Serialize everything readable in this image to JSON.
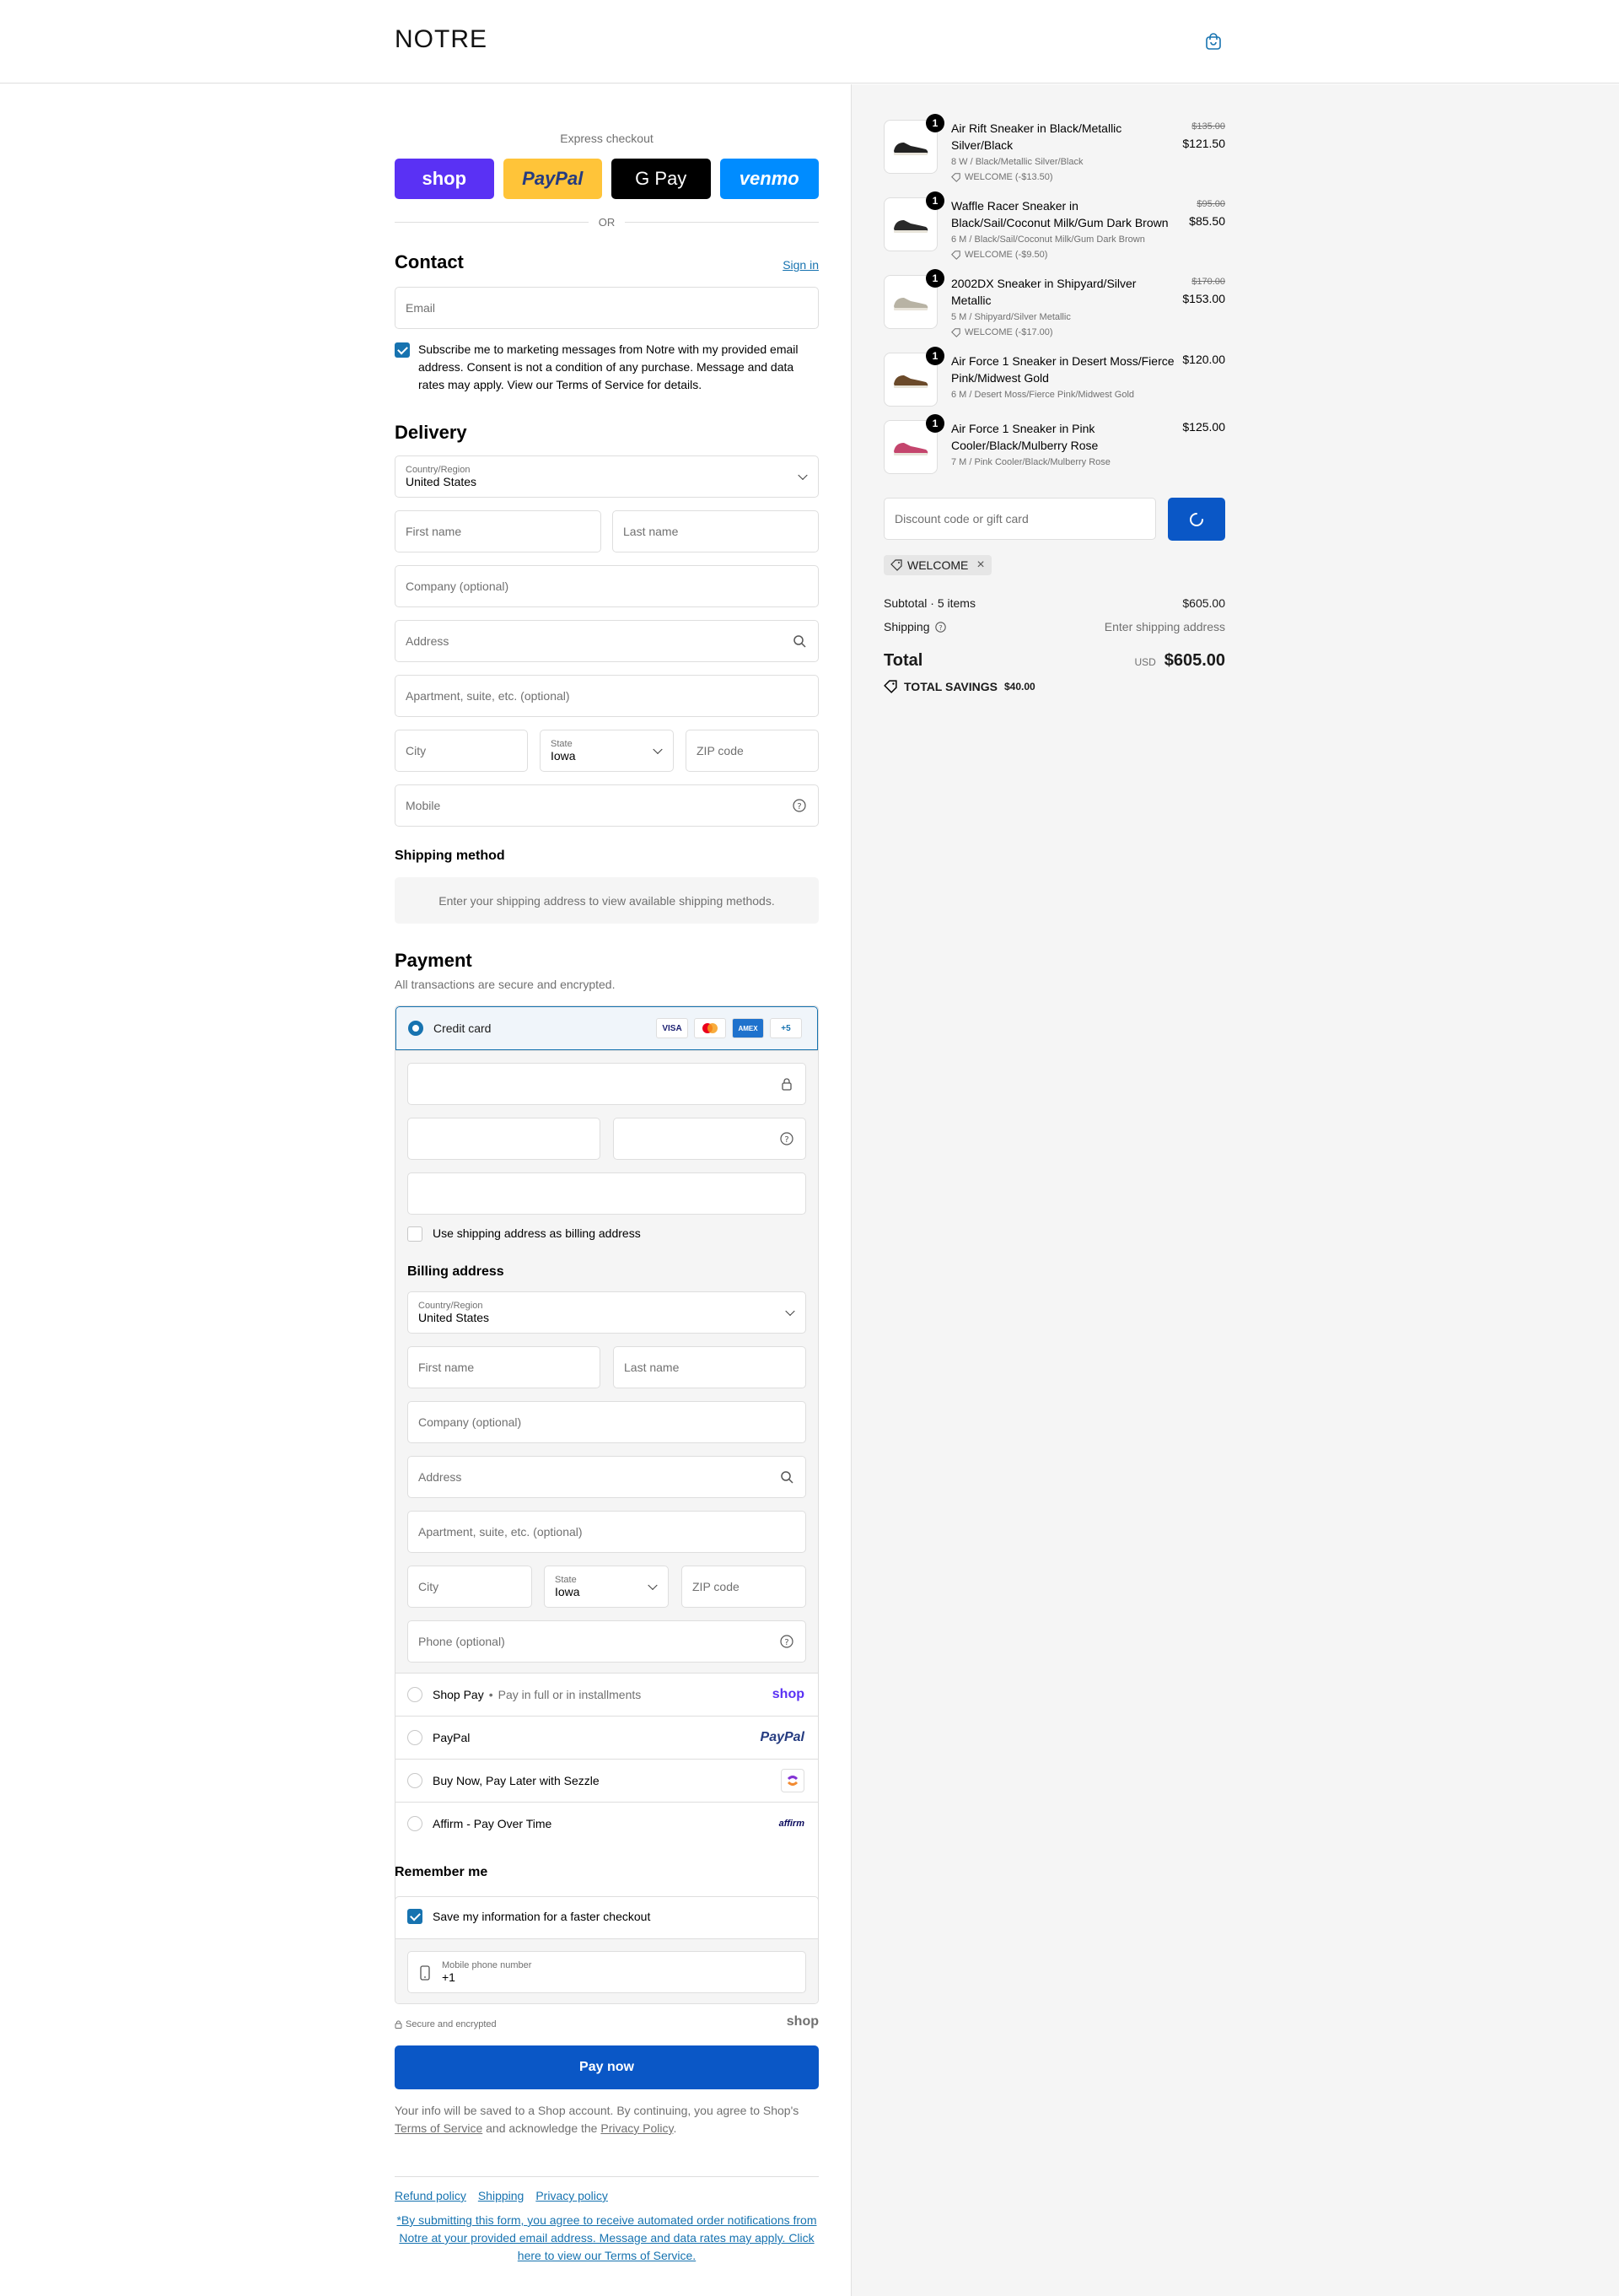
{
  "brand": "NOTRE",
  "express": {
    "title": "Express checkout",
    "buttons": [
      "shop",
      "PayPal",
      "G Pay",
      "venmo"
    ],
    "or": "OR"
  },
  "contact": {
    "title": "Contact",
    "sign_in": "Sign in",
    "email_placeholder": "Email",
    "subscribe_text": "Subscribe me to marketing messages from Notre with my provided email address. Consent is not a condition of any purchase. Message and data rates may apply. View our Terms of Service for details."
  },
  "delivery": {
    "title": "Delivery",
    "country_label": "Country/Region",
    "country_value": "United States",
    "first_name": "First name",
    "last_name": "Last name",
    "company": "Company (optional)",
    "address": "Address",
    "apartment": "Apartment, suite, etc. (optional)",
    "city": "City",
    "state_label": "State",
    "state_value": "Iowa",
    "zip": "ZIP code",
    "mobile": "Mobile"
  },
  "shipping_method": {
    "title": "Shipping method",
    "message": "Enter your shipping address to view available shipping methods."
  },
  "payment": {
    "title": "Payment",
    "subtitle": "All transactions are secure and encrypted.",
    "credit_card": "Credit card",
    "card_badges": [
      "VISA",
      "MC",
      "AMEX",
      "+5"
    ],
    "use_shipping": "Use shipping address as billing address",
    "billing_title": "Billing address",
    "billing": {
      "country_label": "Country/Region",
      "country_value": "United States",
      "first_name": "First name",
      "last_name": "Last name",
      "company": "Company (optional)",
      "address": "Address",
      "apartment": "Apartment, suite, etc. (optional)",
      "city": "City",
      "state_label": "State",
      "state_value": "Iowa",
      "zip": "ZIP code",
      "phone": "Phone (optional)"
    },
    "shop_pay": "Shop Pay",
    "shop_pay_sub": "Pay in full or in installments",
    "shop_logo": "shop",
    "paypal": "PayPal",
    "paypal_logo": "PayPal",
    "sezzle": "Buy Now, Pay Later with Sezzle",
    "affirm": "Affirm - Pay Over Time",
    "affirm_logo": "affirm"
  },
  "remember": {
    "title": "Remember me",
    "save_label": "Save my information for a faster checkout",
    "phone_label": "Mobile phone number",
    "phone_value": "+1"
  },
  "secure": "Secure and encrypted",
  "secure_logo": "shop",
  "pay_now": "Pay now",
  "legal": {
    "p1": "Your info will be saved to a Shop account. By continuing, you agree to Shop's",
    "tos": "Terms of Service",
    "p2": "and acknowledge the",
    "privacy": "Privacy Policy",
    "p3": "."
  },
  "footer": {
    "links": [
      "Refund policy",
      "Shipping",
      "Privacy policy"
    ],
    "notice": "*By submitting this form, you agree to receive automated order notifications from Notre at your provided email address. Message and data rates may apply. Click here to view our Terms of Service."
  },
  "cart": {
    "items": [
      {
        "qty": "1",
        "name": "Air Rift Sneaker in Black/Metallic Silver/Black",
        "variant": "8 W / Black/Metallic Silver/Black",
        "discount": "WELCOME (-$13.50)",
        "old_price": "$135.00",
        "price": "$121.50",
        "color": "#222222"
      },
      {
        "qty": "1",
        "name": "Waffle Racer Sneaker in Black/Sail/Coconut Milk/Gum Dark Brown",
        "variant": "6 M / Black/Sail/Coconut Milk/Gum Dark Brown",
        "discount": "WELCOME (-$9.50)",
        "old_price": "$95.00",
        "price": "$85.50",
        "color": "#2a2a2a"
      },
      {
        "qty": "1",
        "name": "2002DX Sneaker in Shipyard/Silver Metallic",
        "variant": "5 M / Shipyard/Silver Metallic",
        "discount": "WELCOME (-$17.00)",
        "old_price": "$170.00",
        "price": "$153.00",
        "color": "#b8b3a4"
      },
      {
        "qty": "1",
        "name": "Air Force 1 Sneaker in Desert Moss/Fierce Pink/Midwest Gold",
        "variant": "6 M / Desert Moss/Fierce Pink/Midwest Gold",
        "discount": "",
        "old_price": "",
        "price": "$120.00",
        "color": "#6b4a2a"
      },
      {
        "qty": "1",
        "name": "Air Force 1 Sneaker in Pink Cooler/Black/Mulberry Rose",
        "variant": "7 M / Pink Cooler/Black/Mulberry Rose",
        "discount": "",
        "old_price": "",
        "price": "$125.00",
        "color": "#c4456d"
      }
    ],
    "discount_placeholder": "Discount code or gift card",
    "applied_code": "WELCOME",
    "subtotal_label": "Subtotal · 5 items",
    "subtotal_value": "$605.00",
    "shipping_label": "Shipping",
    "shipping_value": "Enter shipping address",
    "total_label": "Total",
    "currency": "USD",
    "total_value": "$605.00",
    "savings_label": "TOTAL SAVINGS",
    "savings_value": "$40.00"
  },
  "colors": {
    "accent": "#1773b0",
    "pay_button": "#0a57c6",
    "shop_purple": "#5a31f4"
  }
}
